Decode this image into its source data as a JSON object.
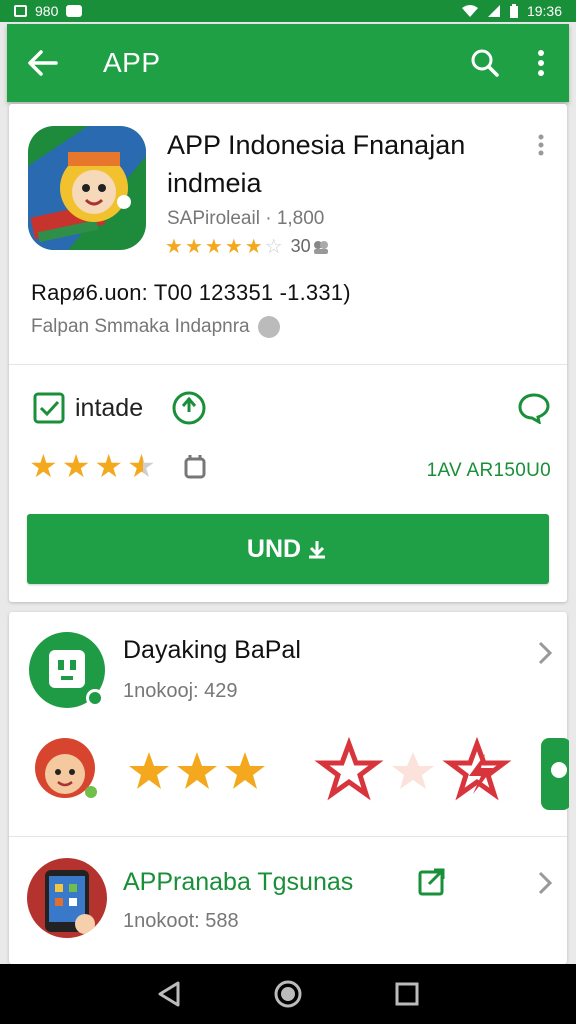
{
  "status_bar": {
    "left_text": "980",
    "time": "19:36"
  },
  "app_bar": {
    "title": "APP"
  },
  "app": {
    "name": "APP Indonesia Fnanajan indmeia",
    "developer": "SAPiroleail · 1,800",
    "rating_count": "30",
    "version": "Rapø6.uon: T00 123351 -1.331)",
    "category": "Falpan Smmaka Indapnra"
  },
  "install": {
    "label": "intade",
    "size": "1AV AR150U0",
    "button_label": "UND",
    "rating_stars": 3.5
  },
  "related": [
    {
      "title": "Dayaking BaPal",
      "subtitle": "1nokooj: 429"
    },
    {
      "title": "APPranaba Tgsunas",
      "subtitle": "1nokoot: 588"
    }
  ],
  "colors": {
    "accent": "#1fa045",
    "star": "#f4a81e",
    "red_star": "#d8343c"
  }
}
